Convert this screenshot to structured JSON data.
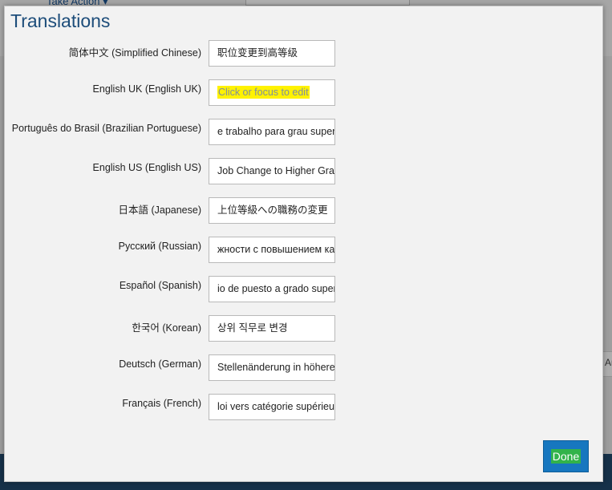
{
  "background": {
    "take_action_label": "Take Action",
    "side_text": "Au"
  },
  "modal": {
    "title": "Translations",
    "done_label": "Done",
    "rows": [
      {
        "label": "简体中文 (Simplified Chinese)",
        "value": "职位变更到高等级",
        "placeholder": ""
      },
      {
        "label": "English UK (English UK)",
        "value": "",
        "placeholder": "Click or focus to edit"
      },
      {
        "label": "Português do Brasil (Brazilian Portuguese)",
        "value": "e trabalho para grau super",
        "placeholder": ""
      },
      {
        "label": "English US (English US)",
        "value": "Job Change to Higher Grad",
        "placeholder": ""
      },
      {
        "label": "日本語 (Japanese)",
        "value": "上位等級への職務の変更",
        "placeholder": ""
      },
      {
        "label": "Русский (Russian)",
        "value": "жности с повышением кат",
        "placeholder": ""
      },
      {
        "label": "Español (Spanish)",
        "value": "io de puesto a grado super",
        "placeholder": ""
      },
      {
        "label": "한국어 (Korean)",
        "value": "상위 직무로 변경",
        "placeholder": ""
      },
      {
        "label": "Deutsch (German)",
        "value": "Stellenänderung in höhere",
        "placeholder": ""
      },
      {
        "label": "Français (French)",
        "value": "loi vers catégorie supérieur",
        "placeholder": ""
      }
    ]
  },
  "colors": {
    "title": "#1d4d7a",
    "done_button": "#1777bf",
    "placeholder_highlight": "#fff200",
    "done_highlight": "#32b34a"
  }
}
